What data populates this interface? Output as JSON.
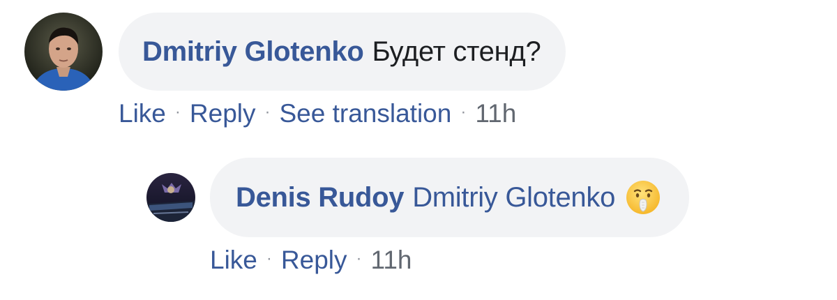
{
  "comments": [
    {
      "author": "Dmitriy Glotenko",
      "text": "Будет стенд?",
      "actions": {
        "like": "Like",
        "reply": "Reply",
        "translate": "See translation",
        "time": "11h"
      },
      "separator": "·"
    }
  ],
  "replies": [
    {
      "author": "Denis Rudoy",
      "mention": "Dmitriy Glotenko",
      "emoji": "shushing-face-icon",
      "actions": {
        "like": "Like",
        "reply": "Reply",
        "time": "11h"
      },
      "separator": "·"
    }
  ],
  "colors": {
    "author": "#385898",
    "bubble": "#f2f3f5",
    "text": "#1c1e21",
    "timestamp": "#616770"
  }
}
